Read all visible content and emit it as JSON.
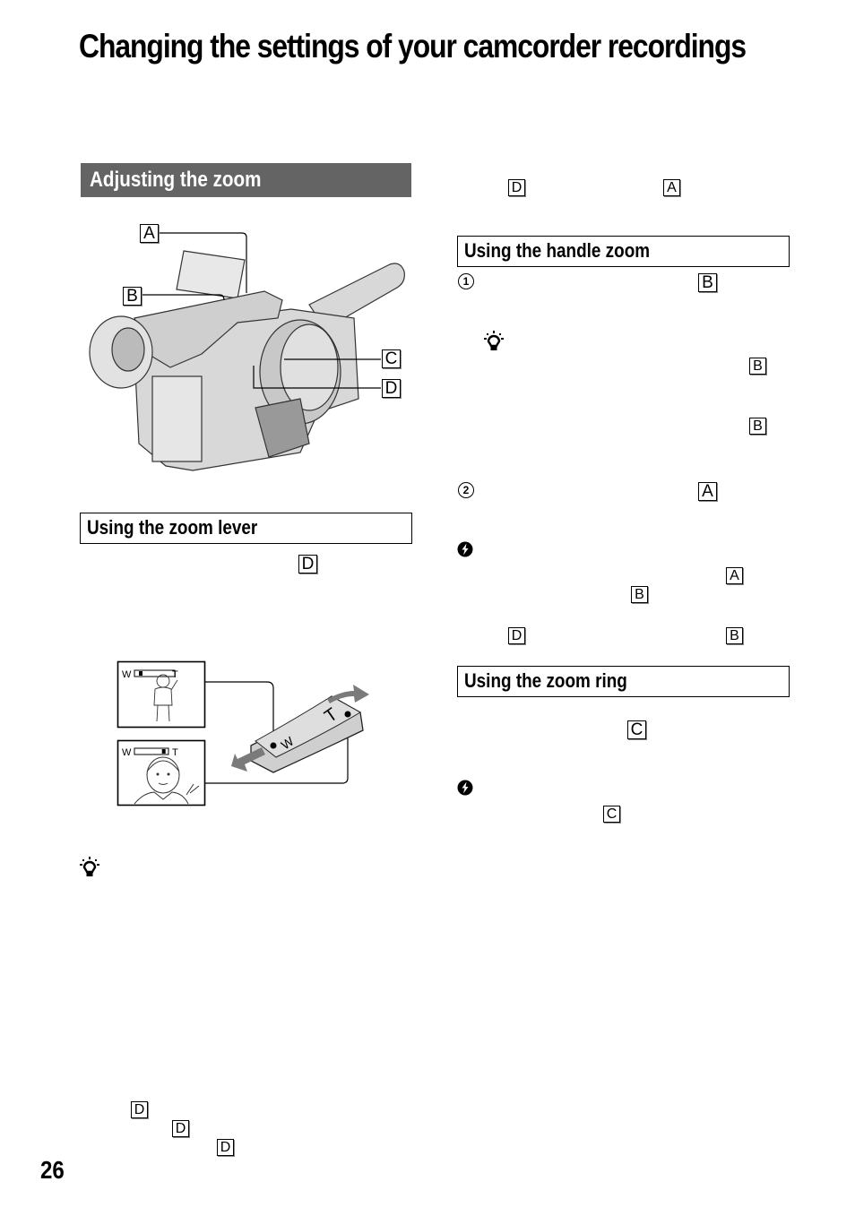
{
  "page": {
    "title": "Changing the settings of your camcorder recordings",
    "page_number": "26"
  },
  "sections": {
    "adjusting_zoom": {
      "heading": "Adjusting the zoom"
    },
    "zoom_lever": {
      "heading": "Using the zoom lever"
    },
    "handle_zoom": {
      "heading": "Using the handle zoom"
    },
    "zoom_ring": {
      "heading": "Using the zoom ring"
    }
  },
  "camera_figure": {
    "callouts": [
      "A",
      "B",
      "C",
      "D"
    ]
  },
  "lever_figure": {
    "wide_label": "W",
    "tele_label": "T",
    "lever_t_mark": "T",
    "lever_w_mark": "W",
    "wide_zoom_level": 0.1,
    "tele_zoom_level": 0.9
  },
  "inline_refs": {
    "right_top_1": "D",
    "right_top_2": "A",
    "handle_step1_ref": "B",
    "handle_tip_ref1": "B",
    "handle_tip_ref2": "B",
    "handle_step2_ref": "A",
    "handle_note_ref1": "A",
    "handle_note_ref2": "B",
    "handle_note_ref3": "D",
    "handle_note_ref4": "B",
    "ring_ref": "C",
    "ring_note_ref": "C",
    "lever_ref": "D",
    "bottom_ref1": "D",
    "bottom_ref2": "D",
    "bottom_ref3": "D"
  },
  "steps": {
    "step1": "1",
    "step2": "2"
  },
  "icons": {
    "tip": "lightbulb-tip-icon",
    "note": "caution-note-icon"
  }
}
